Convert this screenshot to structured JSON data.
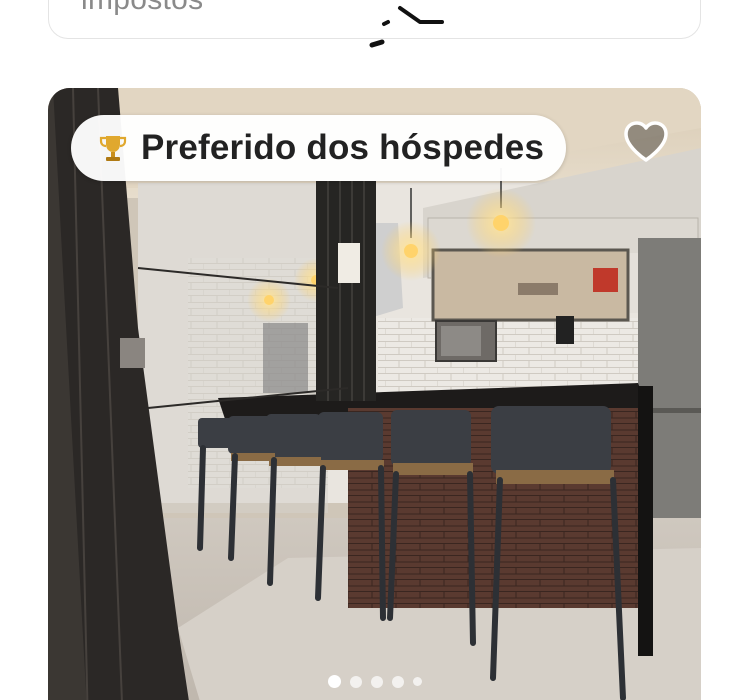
{
  "price_card": {
    "taxes_label": "impostos"
  },
  "listing": {
    "badge": {
      "icon": "trophy-icon",
      "label": "Preferido dos hóspedes"
    },
    "favorite_icon": "heart-icon",
    "carousel": {
      "total": 5,
      "active_index": 0
    }
  },
  "colors": {
    "badge_background": "#ffffff",
    "badge_text": "#222222",
    "taxes_text": "#8a8a8a"
  }
}
